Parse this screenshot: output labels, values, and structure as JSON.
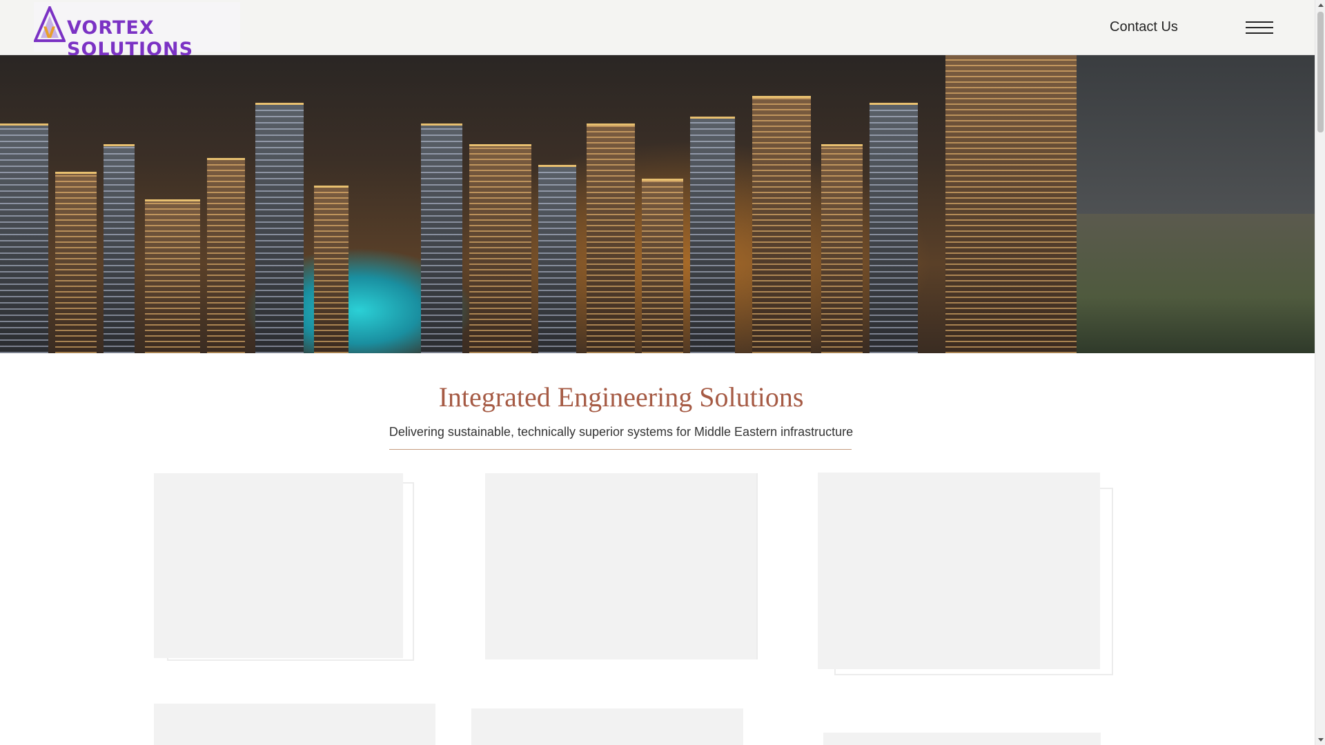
{
  "header": {
    "logo_text": "VORTEX SOLUTIONS",
    "logo_mark": "V",
    "contact_label": "Contact Us",
    "menu_icon": "hamburger-icon"
  },
  "hero": {
    "image_description": "city-skyline-photo"
  },
  "intro": {
    "title": "Integrated Engineering Solutions",
    "subtitle": "Delivering sustainable, technically superior systems for Middle Eastern infrastructure"
  },
  "colors": {
    "title_accent": "#a65b45",
    "logo_purple": "#7b32c4",
    "card_placeholder": "#f2f2f2"
  }
}
